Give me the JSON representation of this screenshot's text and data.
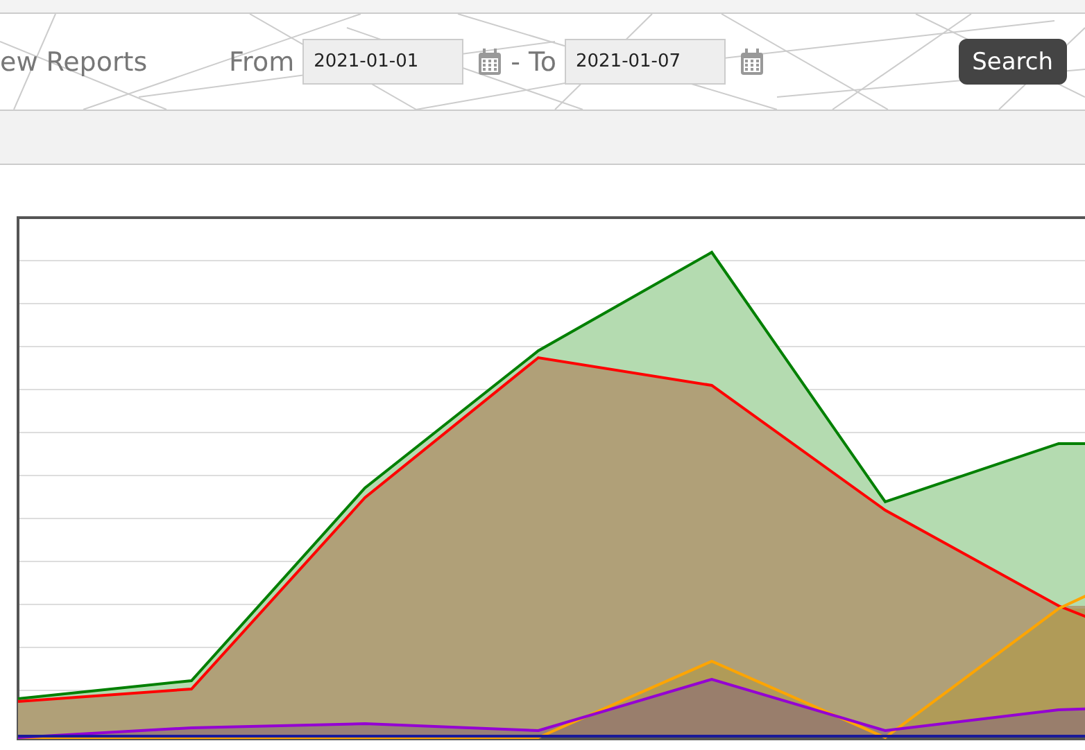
{
  "header": {
    "title": "ew Reports",
    "from_label": "From",
    "from_date": "2021-01-01",
    "to_label": "- To",
    "to_date": "2021-01-07",
    "search_button": "Search"
  }
}
